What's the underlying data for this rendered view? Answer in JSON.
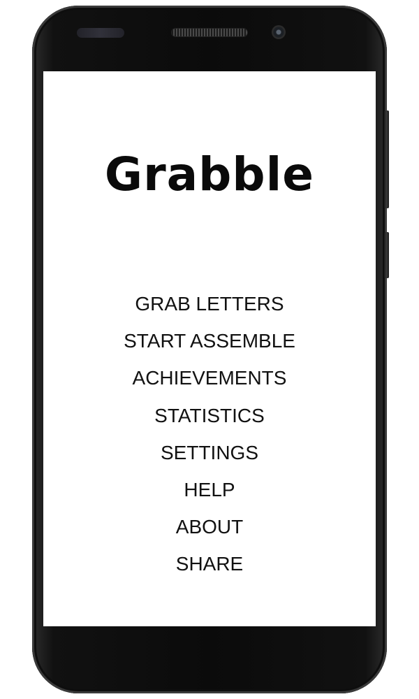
{
  "app": {
    "title": "Grabble"
  },
  "menu": {
    "items": [
      {
        "label": "GRAB LETTERS"
      },
      {
        "label": "START ASSEMBLE"
      },
      {
        "label": "ACHIEVEMENTS"
      },
      {
        "label": "STATISTICS"
      },
      {
        "label": "SETTINGS"
      },
      {
        "label": "HELP"
      },
      {
        "label": "ABOUT"
      },
      {
        "label": "SHARE"
      }
    ]
  },
  "colors": {
    "device_body": "#0b0b0b",
    "screen_background": "#ffffff",
    "text": "#111111"
  }
}
